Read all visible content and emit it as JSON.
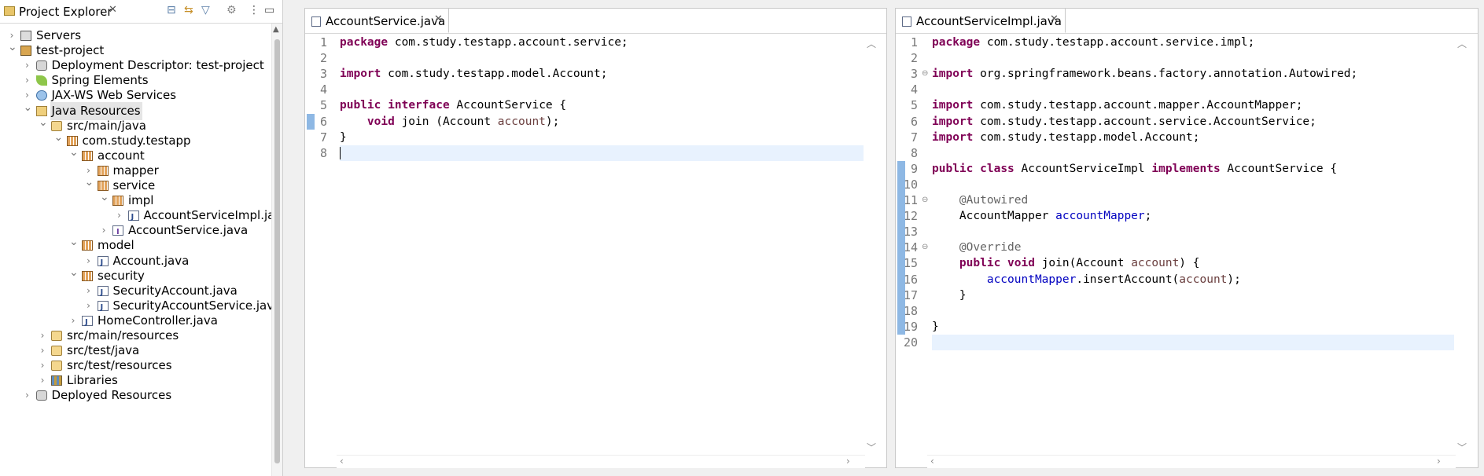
{
  "explorer": {
    "title": "Project Explorer",
    "toolbar_icons": [
      "collapse-all-icon",
      "link-editor-icon",
      "filter-icon",
      "focus-icon",
      "view-menu-icon",
      "minimize-icon",
      "maximize-icon"
    ],
    "tree": [
      {
        "label": "Servers",
        "depth": 0,
        "expanded": false,
        "icon": "servers-icon"
      },
      {
        "label": "test-project",
        "depth": 0,
        "expanded": true,
        "icon": "project-icon"
      },
      {
        "label": "Deployment Descriptor: test-project",
        "depth": 1,
        "expanded": false,
        "icon": "deployment-descriptor-icon"
      },
      {
        "label": "Spring Elements",
        "depth": 1,
        "expanded": false,
        "icon": "spring-icon"
      },
      {
        "label": "JAX-WS Web Services",
        "depth": 1,
        "expanded": false,
        "icon": "web-services-icon"
      },
      {
        "label": "Java Resources",
        "depth": 1,
        "expanded": true,
        "icon": "java-resources-icon",
        "selected": true
      },
      {
        "label": "src/main/java",
        "depth": 2,
        "expanded": true,
        "icon": "source-folder-icon"
      },
      {
        "label": "com.study.testapp",
        "depth": 3,
        "expanded": true,
        "icon": "package-icon"
      },
      {
        "label": "account",
        "depth": 4,
        "expanded": true,
        "icon": "package-icon"
      },
      {
        "label": "mapper",
        "depth": 5,
        "expanded": false,
        "icon": "package-icon"
      },
      {
        "label": "service",
        "depth": 5,
        "expanded": true,
        "icon": "package-icon"
      },
      {
        "label": "impl",
        "depth": 6,
        "expanded": true,
        "icon": "package-icon"
      },
      {
        "label": "AccountServiceImpl.java",
        "depth": 7,
        "expanded": false,
        "icon": "java-file-icon"
      },
      {
        "label": "AccountService.java",
        "depth": 6,
        "expanded": false,
        "icon": "interface-file-icon"
      },
      {
        "label": "model",
        "depth": 4,
        "expanded": true,
        "icon": "package-icon"
      },
      {
        "label": "Account.java",
        "depth": 5,
        "expanded": false,
        "icon": "java-file-icon"
      },
      {
        "label": "security",
        "depth": 4,
        "expanded": true,
        "icon": "package-icon"
      },
      {
        "label": "SecurityAccount.java",
        "depth": 5,
        "expanded": false,
        "icon": "java-file-icon"
      },
      {
        "label": "SecurityAccountService.java",
        "depth": 5,
        "expanded": false,
        "icon": "java-file-icon"
      },
      {
        "label": "HomeController.java",
        "depth": 4,
        "expanded": false,
        "icon": "java-file-icon"
      },
      {
        "label": "src/main/resources",
        "depth": 2,
        "expanded": false,
        "icon": "source-folder-icon"
      },
      {
        "label": "src/test/java",
        "depth": 2,
        "expanded": false,
        "icon": "source-folder-icon"
      },
      {
        "label": "src/test/resources",
        "depth": 2,
        "expanded": false,
        "icon": "source-folder-icon"
      },
      {
        "label": "Libraries",
        "depth": 2,
        "expanded": false,
        "icon": "libraries-icon"
      },
      {
        "label": "Deployed Resources",
        "depth": 1,
        "expanded": false,
        "icon": "deployed-resources-icon"
      }
    ]
  },
  "editors": [
    {
      "tab_title": "AccountService.java",
      "cursor_line": 8,
      "lines": [
        [
          {
            "t": "package",
            "c": "kw"
          },
          {
            "t": " com.study.testapp.account.service;"
          }
        ],
        [],
        [
          {
            "t": "import",
            "c": "kw"
          },
          {
            "t": " com.study.testapp.model.Account;"
          }
        ],
        [],
        [
          {
            "t": "public",
            "c": "kw"
          },
          {
            "t": " "
          },
          {
            "t": "interface",
            "c": "kw"
          },
          {
            "t": " AccountService {"
          }
        ],
        [
          {
            "t": "    "
          },
          {
            "t": "void",
            "c": "kw"
          },
          {
            "t": " join (Account "
          },
          {
            "t": "account",
            "c": "par"
          },
          {
            "t": ");"
          }
        ],
        [
          {
            "t": "}"
          }
        ],
        []
      ]
    },
    {
      "tab_title": "AccountServiceImpl.java",
      "cursor_line": 20,
      "lines": [
        [
          {
            "t": "package",
            "c": "kw"
          },
          {
            "t": " com.study.testapp.account.service.impl;"
          }
        ],
        [],
        [
          {
            "t": "import",
            "c": "kw"
          },
          {
            "t": " org.springframework.beans.factory.annotation.Autowired;"
          }
        ],
        [],
        [
          {
            "t": "import",
            "c": "kw"
          },
          {
            "t": " com.study.testapp.account.mapper.AccountMapper;"
          }
        ],
        [
          {
            "t": "import",
            "c": "kw"
          },
          {
            "t": " com.study.testapp.account.service.AccountService;"
          }
        ],
        [
          {
            "t": "import",
            "c": "kw"
          },
          {
            "t": " com.study.testapp.model.Account;"
          }
        ],
        [],
        [
          {
            "t": "public",
            "c": "kw"
          },
          {
            "t": " "
          },
          {
            "t": "class",
            "c": "kw"
          },
          {
            "t": " AccountServiceImpl "
          },
          {
            "t": "implements",
            "c": "kw"
          },
          {
            "t": " AccountService {"
          }
        ],
        [],
        [
          {
            "t": "    "
          },
          {
            "t": "@Autowired",
            "c": "ann"
          }
        ],
        [
          {
            "t": "    AccountMapper "
          },
          {
            "t": "accountMapper",
            "c": "fld"
          },
          {
            "t": ";"
          }
        ],
        [],
        [
          {
            "t": "    "
          },
          {
            "t": "@Override",
            "c": "ann"
          }
        ],
        [
          {
            "t": "    "
          },
          {
            "t": "public",
            "c": "kw"
          },
          {
            "t": " "
          },
          {
            "t": "void",
            "c": "kw"
          },
          {
            "t": " join(Account "
          },
          {
            "t": "account",
            "c": "par"
          },
          {
            "t": ") {"
          }
        ],
        [
          {
            "t": "        "
          },
          {
            "t": "accountMapper",
            "c": "fld"
          },
          {
            "t": ".insertAccount("
          },
          {
            "t": "account",
            "c": "par"
          },
          {
            "t": ");"
          }
        ],
        [
          {
            "t": "    }"
          }
        ],
        [],
        [
          {
            "t": "}"
          }
        ],
        []
      ]
    }
  ]
}
